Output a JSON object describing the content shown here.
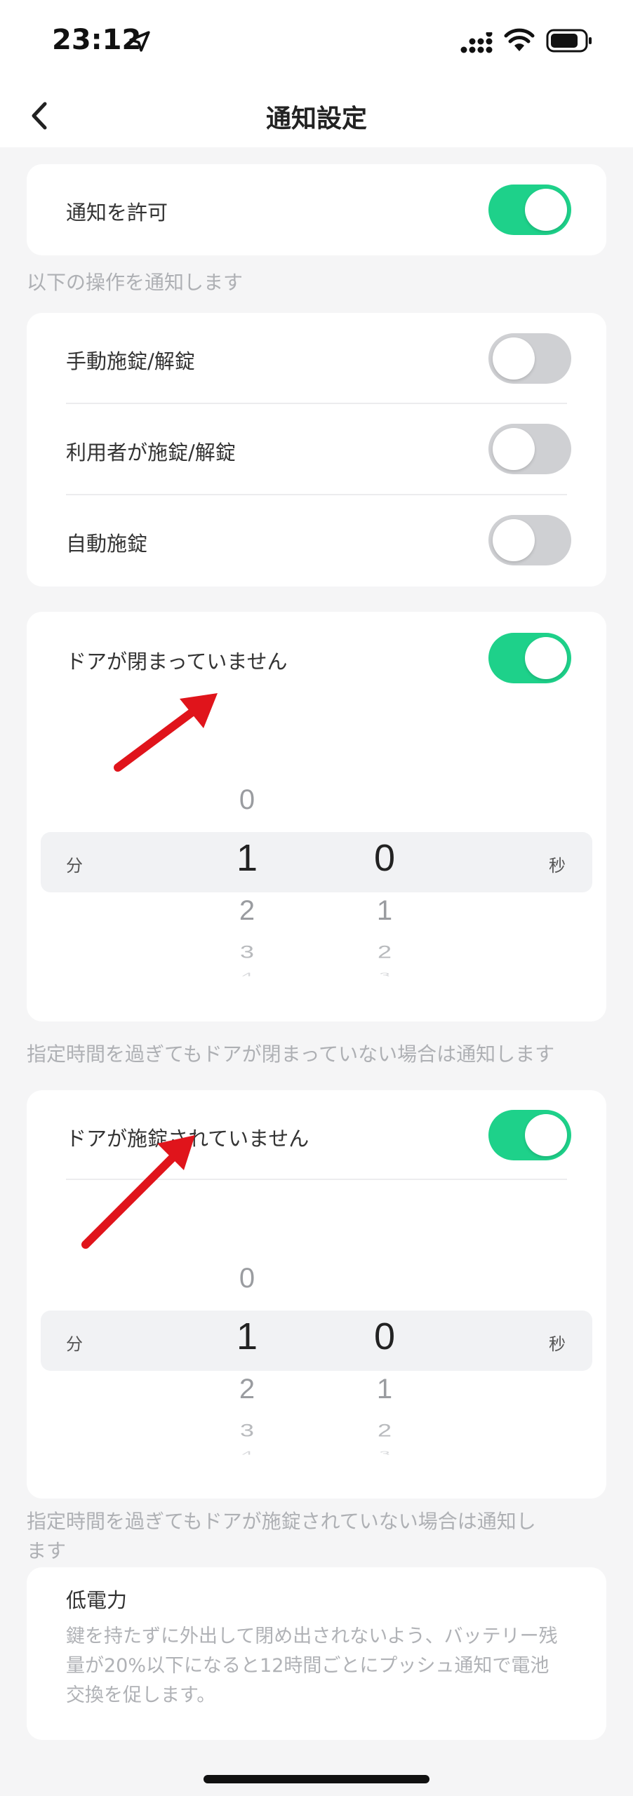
{
  "status_bar": {
    "time": "23:12"
  },
  "nav": {
    "title": "通知設定"
  },
  "allow": {
    "label": "通知を許可",
    "on": true
  },
  "ops": {
    "header": "以下の操作を通知します",
    "items": [
      {
        "label": "手動施錠/解錠",
        "on": false
      },
      {
        "label": "利用者が施錠/解錠",
        "on": false
      },
      {
        "label": "自動施錠",
        "on": false
      }
    ]
  },
  "door_open": {
    "label": "ドアが閉まっていません",
    "on": true,
    "unit_min": "分",
    "unit_sec": "秒",
    "minutes": [
      "0",
      "1",
      "2",
      "3",
      "4"
    ],
    "seconds": [
      "0",
      "1",
      "2",
      "3"
    ],
    "note": "指定時間を過ぎてもドアが閉まっていない場合は通知します"
  },
  "door_unlocked": {
    "label": "ドアが施錠されていません",
    "on": true,
    "unit_min": "分",
    "unit_sec": "秒",
    "minutes": [
      "0",
      "1",
      "2",
      "3",
      "4"
    ],
    "seconds": [
      "0",
      "1",
      "2",
      "3"
    ],
    "note_line1": "指定時間を過ぎてもドアが施錠されていない場合は通知し",
    "note_line2": "ます"
  },
  "low_battery": {
    "title": "低電力",
    "desc": "鍵を持たずに外出して閉め出されないよう、バッテリー残量が20%以下になると12時間ごとにプッシュ通知で電池交換を促します。"
  },
  "colors": {
    "toggle_on": "#1ed18a",
    "toggle_off": "#cfd0d3",
    "arrow": "#e0141b"
  }
}
